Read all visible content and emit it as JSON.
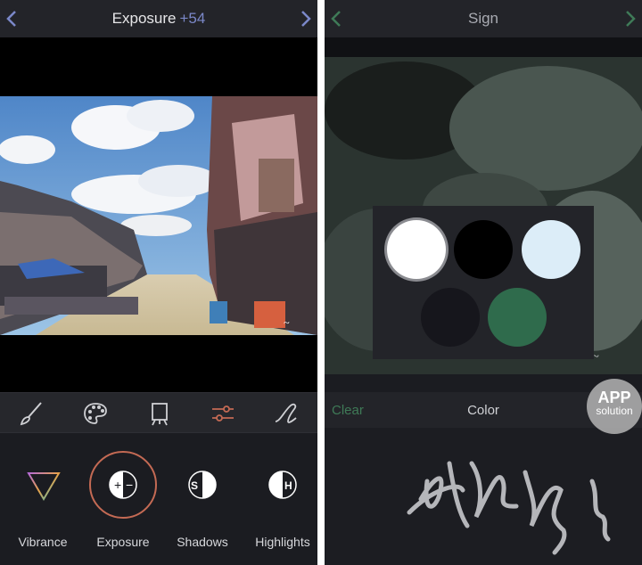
{
  "left": {
    "header": {
      "title": "Exposure",
      "value": "+54"
    },
    "toolbar": {
      "icons": [
        "brush-icon",
        "palette-icon",
        "canvas-icon",
        "sliders-icon",
        "signature-icon"
      ]
    },
    "adjustments": [
      {
        "label": "Vibrance",
        "icon": "vibrance-icon"
      },
      {
        "label": "Exposure",
        "icon": "exposure-icon",
        "selected": true
      },
      {
        "label": "Shadows",
        "icon": "shadows-icon",
        "glyph": "S"
      },
      {
        "label": "Highlights",
        "icon": "highlights-icon",
        "glyph": "H"
      }
    ],
    "exposure_glyph": "+|−"
  },
  "right": {
    "header": {
      "title": "Sign"
    },
    "bottom": {
      "clear": "Clear",
      "color": "Color"
    },
    "colors": [
      "#ffffff",
      "#000000",
      "#dcedf8",
      "#16161c",
      "#2f6b4c"
    ],
    "watermark": {
      "line1": "APP",
      "line2": "solution"
    }
  },
  "colors": {
    "accent_purple": "#7b88c9",
    "accent_green": "#3f7a57",
    "selection_ring": "#c46a54"
  }
}
